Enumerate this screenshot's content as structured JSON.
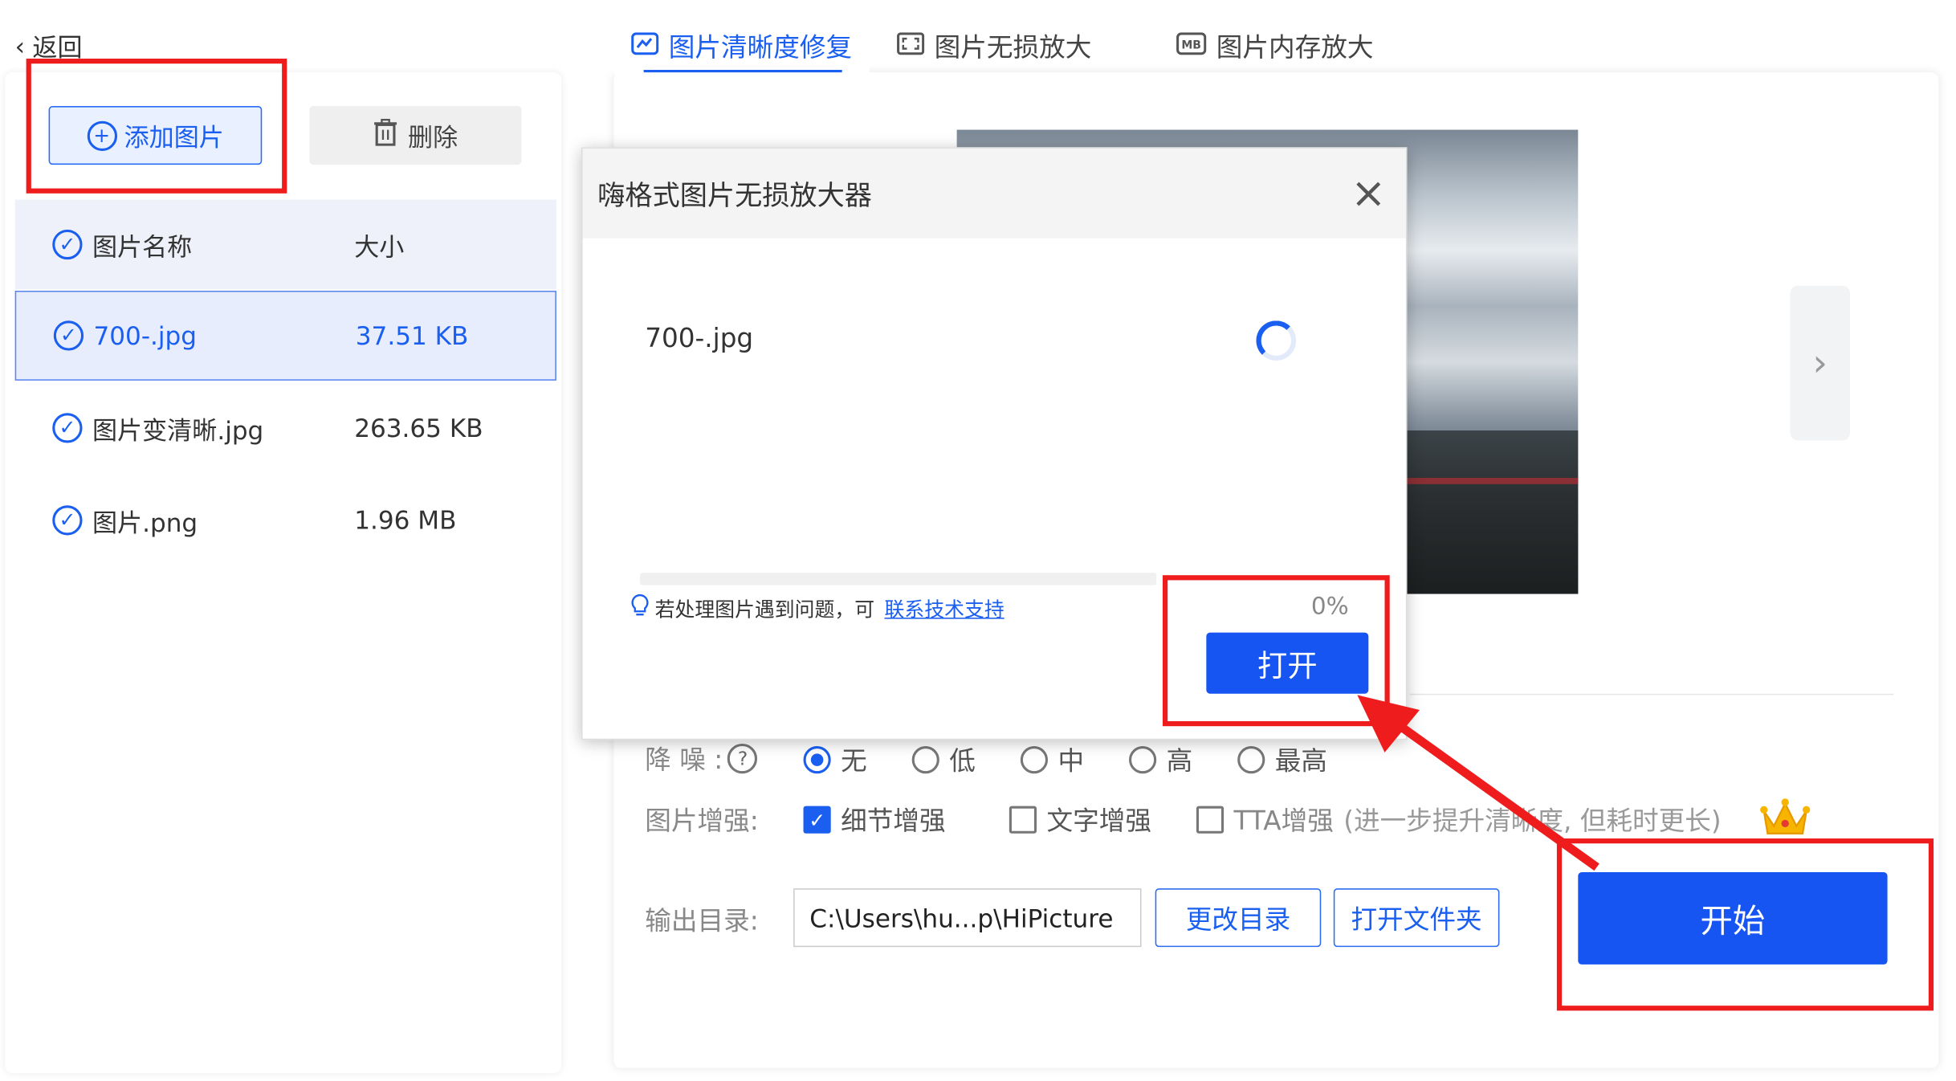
{
  "nav": {
    "back_label": "返回"
  },
  "left": {
    "add_label": "添加图片",
    "delete_label": "删除",
    "header": {
      "name": "图片名称",
      "size": "大小"
    },
    "files": [
      {
        "name": "700-.jpg",
        "size": "37.51 KB",
        "selected": true
      },
      {
        "name": "图片变清晰.jpg",
        "size": "263.65 KB",
        "selected": false
      },
      {
        "name": "图片.png",
        "size": "1.96 MB",
        "selected": false
      }
    ]
  },
  "tabs": [
    {
      "label": "图片清晰度修复",
      "icon": "sharpen-icon",
      "active": true
    },
    {
      "label": "图片无损放大",
      "icon": "enlarge-icon",
      "active": false
    },
    {
      "label": "图片内存放大",
      "icon": "mb-icon",
      "active": false
    }
  ],
  "settings": {
    "denoise_label": "降 噪 :",
    "denoise_options": [
      "无",
      "低",
      "中",
      "高",
      "最高"
    ],
    "denoise_selected": "无",
    "enhance_label": "图片增强:",
    "enhance_options": [
      {
        "label": "细节增强",
        "checked": true
      },
      {
        "label": "文字增强",
        "checked": false
      },
      {
        "label": "TTA增强",
        "checked": false
      }
    ],
    "tta_note": "(进一步提升清晰度, 但耗时更长)",
    "output_label": "输出目录:",
    "output_path": "C:\\Users\\hu...p\\HiPicture",
    "change_dir_label": "更改目录",
    "open_folder_label": "打开文件夹",
    "start_label": "开始"
  },
  "dialog": {
    "title": "嗨格式图片无损放大器",
    "filename": "700-.jpg",
    "help_text": "若处理图片遇到问题，可",
    "help_link": "联系技术支持",
    "progress_text": "0%",
    "progress": 0,
    "open_label": "打开"
  },
  "colors": {
    "accent": "#1755f2",
    "annotation": "#ee1c1c"
  }
}
